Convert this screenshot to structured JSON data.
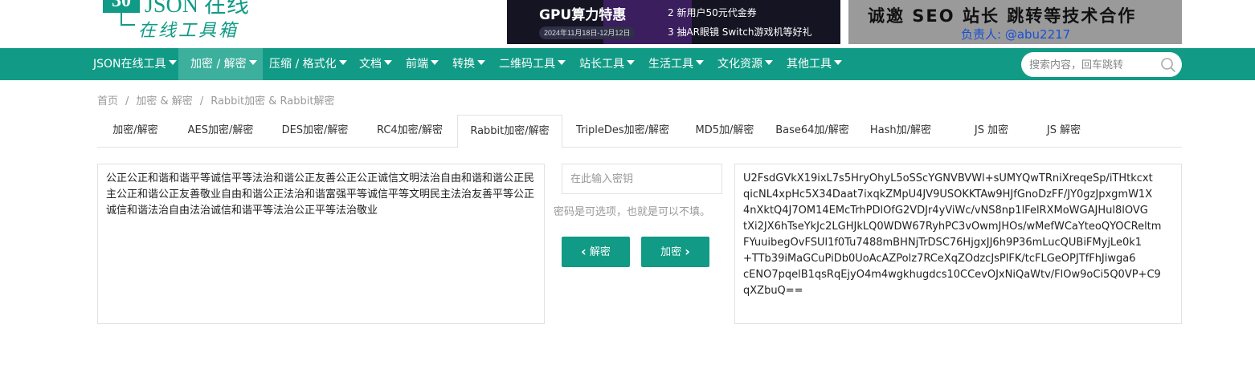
{
  "logo": {
    "box": "30",
    "title": "JSON 在线",
    "subtitle": "在线工具箱"
  },
  "ads": {
    "gpu": {
      "title": "GPU算力特惠",
      "date": "2024年11月18日-12月12日",
      "line1": "2 新用户50元代金券",
      "line2": "3 抽AR眼镜 Switch游戏机等好礼"
    },
    "seo": {
      "main": "诚邀 SEO 站长 跳转等技术合作",
      "contact": "负责人: @abu2217"
    }
  },
  "nav": {
    "items": [
      {
        "label": "JSON在线工具"
      },
      {
        "label": "加密 / 解密"
      },
      {
        "label": "压缩 / 格式化"
      },
      {
        "label": "文档"
      },
      {
        "label": "前端"
      },
      {
        "label": "转换"
      },
      {
        "label": "二维码工具"
      },
      {
        "label": "站长工具"
      },
      {
        "label": "生活工具"
      },
      {
        "label": "文化资源"
      },
      {
        "label": "其他工具"
      }
    ],
    "search_placeholder": "搜索内容，回车跳转"
  },
  "breadcrumb": {
    "home": "首页",
    "category": "加密 & 解密",
    "current": "Rabbit加密 & Rabbit解密",
    "separator": "/"
  },
  "tabs": [
    {
      "label": "加密/解密"
    },
    {
      "label": "AES加密/解密"
    },
    {
      "label": "DES加密/解密"
    },
    {
      "label": "RC4加密/解密"
    },
    {
      "label": "Rabbit加密/解密"
    },
    {
      "label": "TripleDes加密/解密"
    },
    {
      "label": "MD5加/解密"
    },
    {
      "label": "Base64加/解密"
    },
    {
      "label": "Hash加/解密"
    },
    {
      "label": "JS 加密"
    },
    {
      "label": "JS 解密"
    }
  ],
  "tool": {
    "input_text": "公正公正和谐和谐平等诚信平等法治和谐公正友善公正公正诚信文明法治自由和谐和谐公正民主公正和谐公正友善敬业自由和谐公正法治和谐富强平等诚信平等文明民主法治友善平等公正诚信和谐法治自由法治诚信和谐平等法治公正平等法治敬业",
    "key_placeholder": "在此输入密钥",
    "key_hint": "密码是可选项，也就是可以不填。",
    "decrypt_label": "解密",
    "encrypt_label": "加密",
    "output_lines": [
      "U2FsdGVkX19ixL7s5HryOhyL5oSScYGNVBVWl+sUMYQwTRniXreqeSp/iTHtkcxt",
      "qicNL4xpHc5X34Daat7ixqkZMpU4JV9USOKKTAw9HJfGnoDzFF/JY0gzJpxgmW1X",
      "4nXktQ4J7OM14EMcTrhPDlOfG2VDJr4yViWc/vNS8np1lFelRXMoWGAJHul8lOVG",
      "tXi2JX6hTseYkJc2LGHJkLQ0WDW67RyhPC3vOwmJHOs/wMefWCaYteoQYOCReltm",
      "FYuuibegOvFSUl1f0Tu7488mBHNjTrDSC76HjgxJJ6h9P36mLucQUBiFMyjLe0k1",
      "+TTb39iMaGCuPiDb0UoAcAZPolz7RCeXqZOdzcJsPlFK/tcFLGeOPJTfFhJiwga6",
      "cENO7pqelB1qsRqEjyO4m4wgkhugdcs10CCevOJxNiQaWtv/FlOw9oCi5Q0VP+C9",
      "qXZbuQ=="
    ]
  },
  "colors": {
    "brand": "#119b86",
    "nav_active": "#3daf9d",
    "border": "#e2e2e2"
  }
}
